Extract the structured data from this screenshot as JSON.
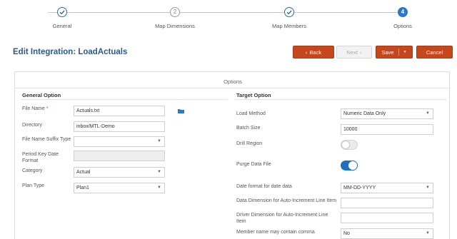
{
  "train": {
    "steps": [
      {
        "label": "General",
        "marker": "check",
        "state": "done"
      },
      {
        "label": "Map Dimensions",
        "marker": "2",
        "state": "pending"
      },
      {
        "label": "Map Members",
        "marker": "check",
        "state": "done"
      },
      {
        "label": "Options",
        "marker": "4",
        "state": "current"
      }
    ]
  },
  "header": {
    "title": "Edit Integration: LoadActuals",
    "back_label": "Back",
    "next_label": "Next",
    "save_label": "Save",
    "cancel_label": "Cancel"
  },
  "panel": {
    "title": "Options",
    "general": {
      "heading": "General Option",
      "file_name_label": "File Name",
      "required_mark": "*",
      "file_name_value": "Actuals.txt",
      "directory_label": "Directory",
      "directory_value": "inbox/MTL-Demo",
      "suffix_label": "File Name Suffix Type",
      "suffix_value": "",
      "period_key_label": "Period Key Date Format",
      "period_key_value": "",
      "category_label": "Category",
      "category_value": "Actual",
      "plan_type_label": "Plan Type",
      "plan_type_value": "Plan1"
    },
    "target": {
      "heading": "Target Option",
      "load_method_label": "Load Method",
      "load_method_value": "Numeric Data Only",
      "batch_size_label": "Batch Size",
      "batch_size_value": "10000",
      "drill_region_label": "Drill Region",
      "drill_region_on": false,
      "purge_label": "Purge Data File",
      "purge_on": true,
      "date_format_label": "Date format for date data",
      "date_format_value": "MM-DD-YYYY",
      "data_dim_label": "Data Dimension for Auto-Increment Line Item",
      "data_dim_value": "",
      "driver_dim_label": "Driver Dimension for Auto-Increment Line Item",
      "driver_dim_value": "",
      "member_comma_label": "Member name may contain comma",
      "member_comma_value": "No"
    }
  },
  "icons": {
    "check": "check-icon",
    "folder": "folder-icon",
    "caret": "caret-down-icon"
  },
  "colors": {
    "accent_blue": "#2a78c8",
    "title_blue": "#2a5a86",
    "button_red": "#c6461d",
    "toggle_on": "#1f6fc0"
  }
}
